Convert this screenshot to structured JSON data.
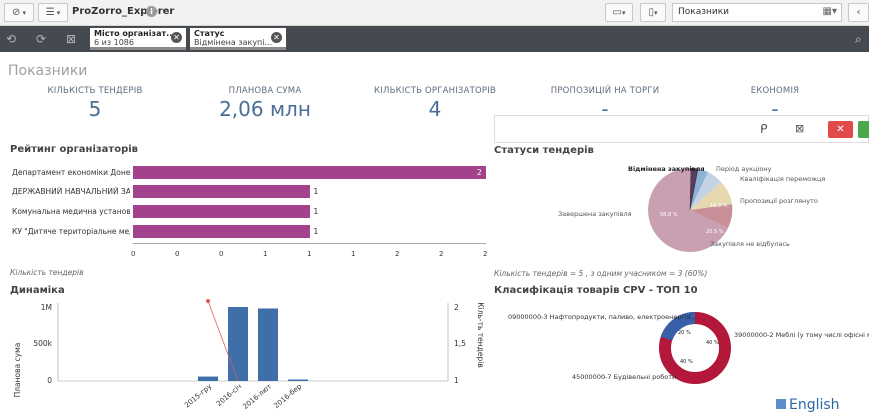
{
  "toolbar": {
    "app_title": "ProZorro_Explorer",
    "sheet_name": "Показники"
  },
  "selections": [
    {
      "field": "Місто організат...",
      "value": "6 из 1086"
    },
    {
      "field": "Статус",
      "value": "Відмінена закупі..."
    }
  ],
  "sheet_title": "Показники",
  "kpis": [
    {
      "label": "КІЛЬКІСТЬ ТЕНДЕРІВ",
      "value": "5"
    },
    {
      "label": "ПЛАНОВА СУМА",
      "value": "2,06 млн"
    },
    {
      "label": "КІЛЬКІСТЬ ОРГАНІЗАТОРІВ",
      "value": "4"
    },
    {
      "label": "ПРОПОЗИЦІЙ НА ТОРГИ",
      "value": "-"
    },
    {
      "label": "ЕКОНОМІЯ",
      "value": "-"
    }
  ],
  "ranking": {
    "title": "Рейтинг організаторів",
    "footnote": "Кількість тендерів",
    "x_ticks": [
      "0",
      "0",
      "0",
      "1",
      "1",
      "1",
      "2",
      "2",
      "2"
    ],
    "bars": [
      {
        "label": "Департамент економіки Донецьк...",
        "value": 2
      },
      {
        "label": "ДЕРЖАВНИЙ НАВЧАЛЬНИЙ ЗАК...",
        "value": 1
      },
      {
        "label": "Комунальна медична установа \"Мі...",
        "value": 1
      },
      {
        "label": "КУ \"Дитяче територіальне медичн...",
        "value": 1
      }
    ]
  },
  "statuses": {
    "title": "Статуси тендерів",
    "footnote": "Кількість тендерів = 5 , з одним учасником = 3 (60%)",
    "labels": {
      "cancelled": "Відмінена закупівля",
      "period": "Період аукціону",
      "qualification": "Кваліфікація переможця",
      "proposals": "Пропозиції розглянуто",
      "completed": "Завершена закупівля",
      "failed": "Закупівля не відбулась"
    },
    "pct_completed": "58.8 %",
    "pct_proposals": "16.3 %",
    "pct_failed": "20.5 %",
    "colors": {
      "completed": "#c9a0b2",
      "failed": "#c98f98",
      "proposals": "#e6d9b0",
      "qualification": "#c3d3e4",
      "period": "#8fb3d4",
      "cancelled": "#5a3a60"
    }
  },
  "dynamics": {
    "title": "Динаміка",
    "y_left_label": "Планова сума",
    "y_right_label": "Кіль-ть тендерів",
    "y_left_ticks": [
      "1M",
      "500k",
      "0"
    ],
    "y_right_ticks": [
      "2",
      "1,5",
      "1"
    ],
    "categories": [
      "2015-гру",
      "2016-січ",
      "2016-лют",
      "2016-бер"
    ],
    "bar_values": [
      60000,
      1000000,
      980000,
      20000
    ],
    "bar_color": "#3f6fa8",
    "line_color": "#e05a5a"
  },
  "cpv": {
    "title": "Класифікація товарів CPV - ТОП 10",
    "items": [
      {
        "label": "09000000-3 Нафтопродукти, паливо, електроенергія...",
        "pct": "20 %",
        "color": "#3760a8"
      },
      {
        "label": "39000000-2 Меблі (у тому числі офісні меблі)",
        "pct": "40 %",
        "color": "#b3173a"
      },
      {
        "label": "45000000-7 Будівельні роботи",
        "pct": "40 %",
        "color": "#b3173a"
      }
    ]
  },
  "language": "English"
}
